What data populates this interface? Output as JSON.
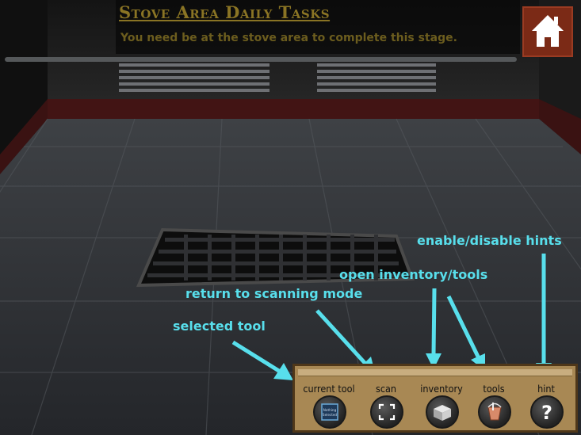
{
  "task_banner": {
    "title": "Stove Area Daily Tasks",
    "description": "You need be at the stove area to complete this stage.",
    "progress": 0
  },
  "home_button": {
    "icon": "house-icon"
  },
  "annotations": {
    "selected_tool": "selected tool",
    "scan": "return to scanning mode",
    "inventory": "open inventory/tools",
    "hints": "enable/disable hints"
  },
  "toolbar": {
    "current_tool_label": "current tool",
    "current_tool_value": "Nothing Selected",
    "scan_label": "scan",
    "inventory_label": "inventory",
    "tools_label": "tools",
    "hint_label": "hint",
    "hint_glyph": "?"
  },
  "colors": {
    "annotation": "#58dfec",
    "banner_title": "#8a7424",
    "toolbar_wood": "#a88854",
    "home_button": "#7b2a16"
  }
}
